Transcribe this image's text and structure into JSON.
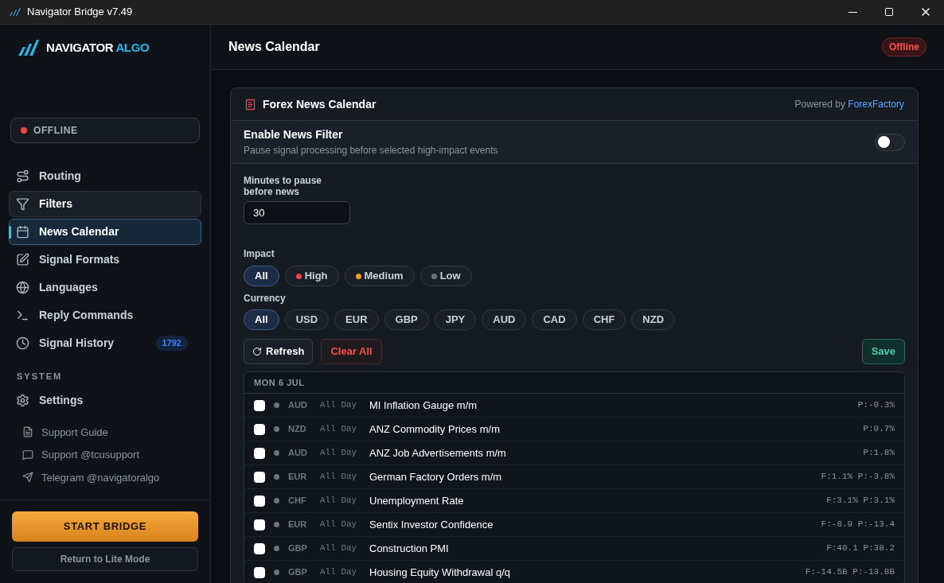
{
  "window": {
    "title": "Navigator Bridge v7.49"
  },
  "sidebar": {
    "logo": {
      "word1": "NAVIGATOR",
      "word2": "ALGO"
    },
    "status": {
      "label": "OFFLINE",
      "color": "#ef4444"
    },
    "items": [
      {
        "label": "Routing",
        "selected": false,
        "hovered": false
      },
      {
        "label": "Filters",
        "selected": false,
        "hovered": true
      },
      {
        "label": "News Calendar",
        "selected": true,
        "hovered": false
      },
      {
        "label": "Signal Formats",
        "selected": false,
        "hovered": false
      },
      {
        "label": "Languages",
        "selected": false,
        "hovered": false
      },
      {
        "label": "Reply Commands",
        "selected": false,
        "hovered": false
      },
      {
        "label": "Signal History",
        "selected": false,
        "hovered": false,
        "badge": "1792"
      }
    ],
    "section": "SYSTEM",
    "system_items": [
      {
        "label": "Settings",
        "selected": false,
        "hovered": false
      }
    ],
    "links": [
      "Support Guide",
      "Support @tcusupport",
      "Telegram @navigatoralgo"
    ],
    "start_button": "START BRIDGE",
    "lite_button": "Return to Lite Mode"
  },
  "header": {
    "title": "News Calendar",
    "badge": "Offline"
  },
  "card": {
    "title": "Forex News Calendar",
    "powered_by": "Powered by",
    "provider": "ForexFactory",
    "filter": {
      "title": "Enable News Filter",
      "description": "Pause signal processing before selected high-impact events",
      "on": false
    },
    "minutes": {
      "label": "Minutes to pause before news",
      "value": "30"
    },
    "impact": {
      "label": "Impact",
      "options": [
        {
          "label": "All",
          "selected": true
        },
        {
          "label": "High",
          "selected": false,
          "color": "#ef4444"
        },
        {
          "label": "Medium",
          "selected": false,
          "color": "#f59e0b"
        },
        {
          "label": "Low",
          "selected": false,
          "color": "#6b7280"
        }
      ]
    },
    "currency": {
      "label": "Currency",
      "options": [
        {
          "label": "All",
          "selected": true
        },
        {
          "label": "USD",
          "selected": false
        },
        {
          "label": "EUR",
          "selected": false
        },
        {
          "label": "GBP",
          "selected": false
        },
        {
          "label": "JPY",
          "selected": false
        },
        {
          "label": "AUD",
          "selected": false
        },
        {
          "label": "CAD",
          "selected": false
        },
        {
          "label": "CHF",
          "selected": false
        },
        {
          "label": "NZD",
          "selected": false
        }
      ]
    },
    "buttons": {
      "refresh": "Refresh",
      "clear": "Clear All",
      "save": "Save"
    },
    "day": "MON 6 JUL",
    "events": [
      {
        "checked": false,
        "color": "#6b7280",
        "currency": "AUD",
        "time": "All Day",
        "title": "MI Inflation Gauge m/m",
        "values": "P:-0.3%"
      },
      {
        "checked": false,
        "color": "#6b7280",
        "currency": "NZD",
        "time": "All Day",
        "title": "ANZ Commodity Prices m/m",
        "values": "P:0.7%"
      },
      {
        "checked": false,
        "color": "#6b7280",
        "currency": "AUD",
        "time": "All Day",
        "title": "ANZ Job Advertisements m/m",
        "values": "P:1.8%"
      },
      {
        "checked": false,
        "color": "#6b7280",
        "currency": "EUR",
        "time": "All Day",
        "title": "German Factory Orders m/m",
        "values": "F:1.1% P:-3.8%"
      },
      {
        "checked": false,
        "color": "#6b7280",
        "currency": "CHF",
        "time": "All Day",
        "title": "Unemployment Rate",
        "values": "F:3.1% P:3.1%"
      },
      {
        "checked": false,
        "color": "#6b7280",
        "currency": "EUR",
        "time": "All Day",
        "title": "Sentix Investor Confidence",
        "values": "F:-8.9 P:-13.4"
      },
      {
        "checked": false,
        "color": "#6b7280",
        "currency": "GBP",
        "time": "All Day",
        "title": "Construction PMI",
        "values": "F:40.1 P:38.2"
      },
      {
        "checked": false,
        "color": "#6b7280",
        "currency": "GBP",
        "time": "All Day",
        "title": "Housing Equity Withdrawal q/q",
        "values": "F:-14.5B P:-13.8B"
      }
    ]
  }
}
